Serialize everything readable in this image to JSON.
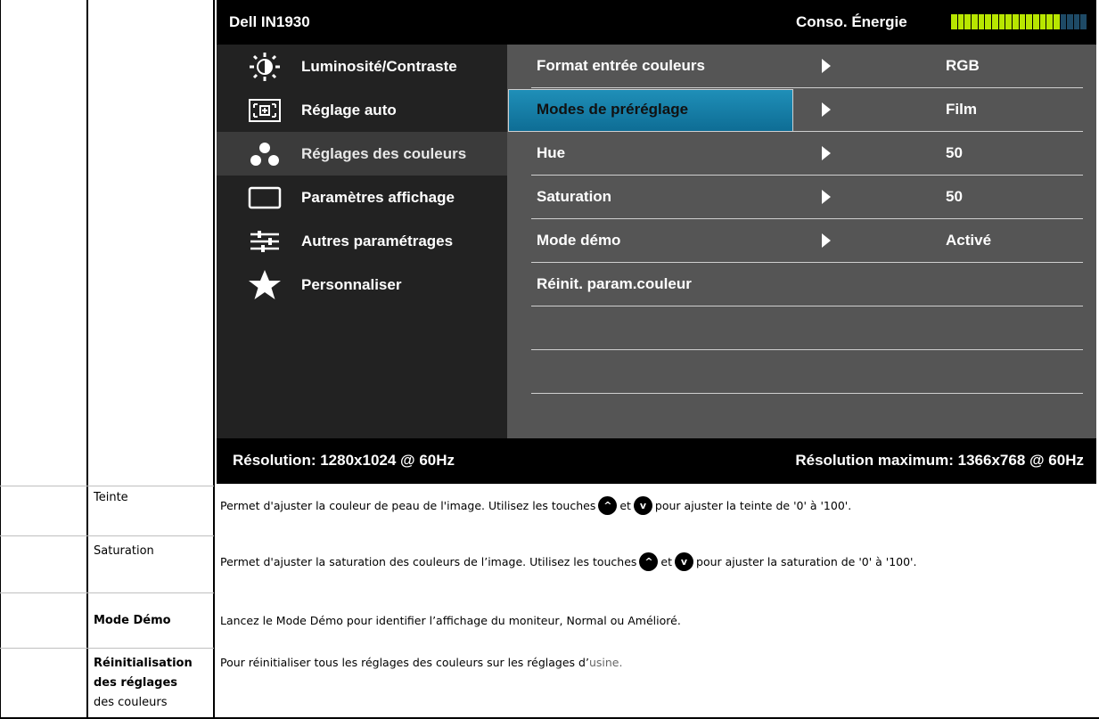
{
  "osd": {
    "title": "Dell IN1930",
    "energy_label": "Conso. Énergie",
    "energy_level": 0.8,
    "colors": {
      "accent": "#1a86b2",
      "energy_on": "#b8e600",
      "energy_off": "#1e4a66"
    },
    "menu": [
      {
        "label": "Luminosité/Contraste",
        "icon": "brightness-icon"
      },
      {
        "label": "Réglage auto",
        "icon": "auto-adjust-icon"
      },
      {
        "label": "Réglages des couleurs",
        "icon": "color-settings-icon",
        "selected": true
      },
      {
        "label": "Paramètres affichage",
        "icon": "display-icon"
      },
      {
        "label": "Autres paramétrages",
        "icon": "other-settings-icon"
      },
      {
        "label": "Personnaliser",
        "icon": "star-icon"
      }
    ],
    "rows": [
      {
        "label": "Format entrée couleurs",
        "value": "RGB"
      },
      {
        "label": "Modes de préréglage",
        "value": "Film",
        "highlighted": true
      },
      {
        "label": "Hue",
        "value": "50"
      },
      {
        "label": "Saturation",
        "value": "50"
      },
      {
        "label": "Mode démo",
        "value": "Activé"
      },
      {
        "label": "Réinit. param.couleur",
        "value": ""
      }
    ],
    "footer": {
      "resolution": "Résolution: 1280x1024 @ 60Hz",
      "max_resolution": "Résolution maximum: 1366x768 @ 60Hz"
    }
  },
  "descriptions": {
    "teinte": {
      "label": "Teinte",
      "text_before": "Permet d'ajuster la couleur de peau de l'image. Utilisez les touches",
      "text_and": "et",
      "text_after": "pour ajuster la teinte de '0' à '100'."
    },
    "saturation": {
      "label": "Saturation",
      "text_before": "Permet d'ajuster la saturation des couleurs de l’image. Utilisez les touches",
      "text_and": "et",
      "text_after": "pour ajuster la saturation de '0' à '100'."
    },
    "mode_demo": {
      "label": "Mode Démo",
      "text": "Lancez le Mode Démo pour identifier l’affichage du moniteur, Normal ou Amélioré."
    },
    "reinit": {
      "label_line1": "Réinitialisation",
      "label_line2": "des réglages",
      "label_line3": "des couleurs",
      "text_main": "Pour réinitialiser tous les réglages des couleurs sur les réglages d’",
      "text_tail": "usine."
    },
    "key_up": "^",
    "key_down": "v"
  }
}
